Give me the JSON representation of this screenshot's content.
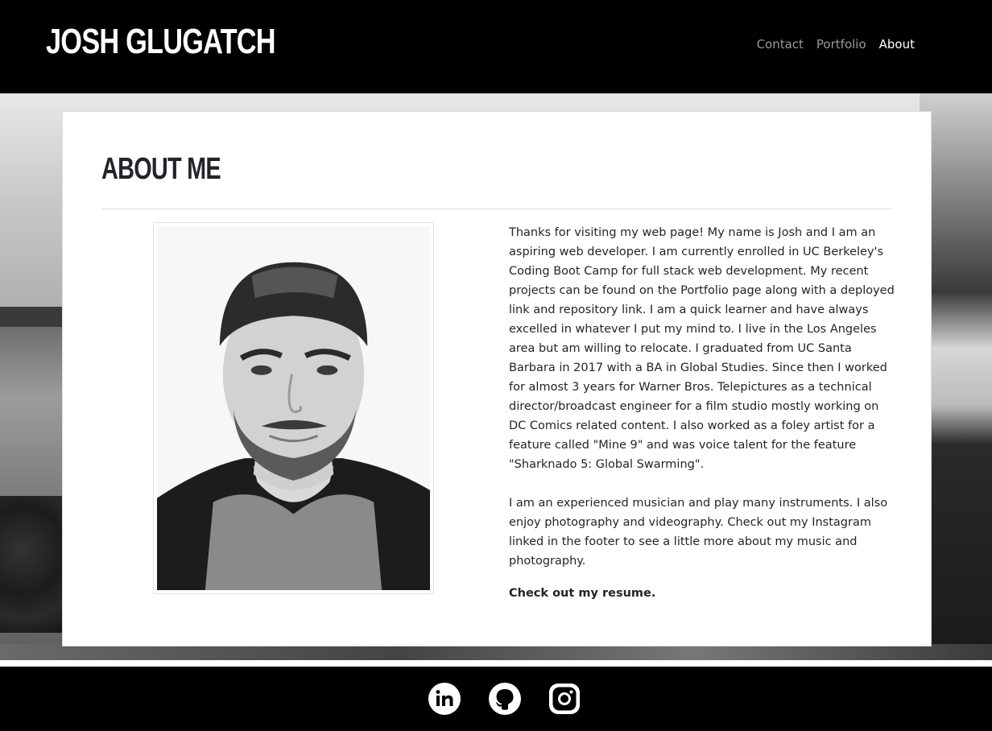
{
  "header": {
    "brand": "JOSH GLUGATCH",
    "nav": [
      {
        "label": "Contact",
        "active": false
      },
      {
        "label": "Portfolio",
        "active": false
      },
      {
        "label": "About",
        "active": true
      }
    ]
  },
  "about": {
    "title": "ABOUT ME",
    "paragraph_1": "Thanks for visiting my web page! My name is Josh and I am an aspiring web developer. I am currently enrolled in UC Berkeley's Coding Boot Camp for full stack web development. My recent projects can be found on the Portfolio page along with a deployed link and repository link. I am a quick learner and have always excelled in whatever I put my mind to. I live in the Los Angeles area but am willing to relocate. I graduated from UC Santa Barbara in 2017 with a BA in Global Studies. Since then I worked for almost 3 years for Warner Bros. Telepictures as a technical director/broadcast engineer for a film studio mostly working on DC Comics related content. I also worked as a foley artist for a feature called \"Mine 9\" and was voice talent for the feature \"Sharknado 5: Global Swarming\".",
    "paragraph_2": "I am an experienced musician and play many instruments. I also enjoy photography and videography. Check out my Instagram linked in the footer to see a little more about my music and photography.",
    "resume_link": "Check out my resume."
  },
  "footer": {
    "icons": [
      "linkedin-icon",
      "github-icon",
      "instagram-icon"
    ]
  },
  "colors": {
    "header_bg": "#000000",
    "nav_active": "#ffffff",
    "nav_inactive": "#9a9a9a",
    "card_bg": "#ffffff",
    "text": "#212529"
  }
}
